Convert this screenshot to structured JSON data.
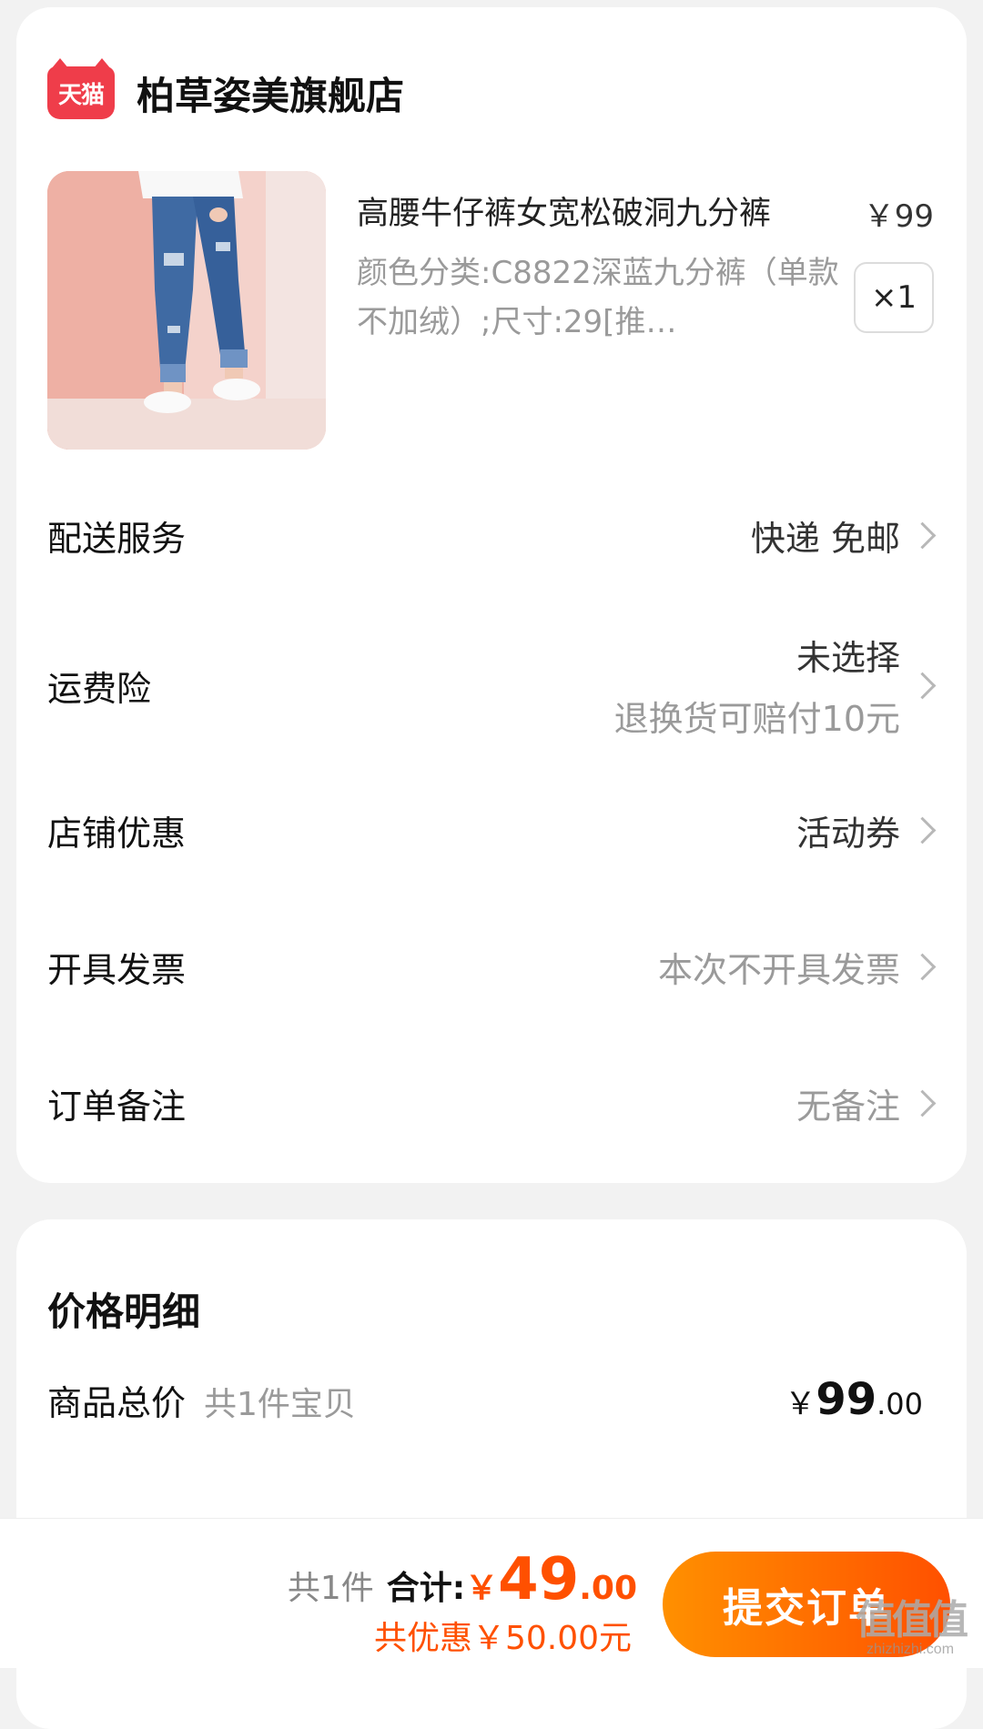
{
  "store": {
    "logo_text": "天猫",
    "name": "柏草姿美旗舰店"
  },
  "product": {
    "title": "高腰牛仔裤女宽松破洞九分裤",
    "price": "￥99",
    "sku": "颜色分类:C8822深蓝九分裤（单款不加绒）;尺寸:29[推…",
    "quantity": "×1"
  },
  "rows": {
    "delivery": {
      "label": "配送服务",
      "value": "快递 免邮"
    },
    "shipping_insurance": {
      "label": "运费险",
      "value": "未选择",
      "sub": "退换货可赔付10元"
    },
    "store_discount": {
      "label": "店铺优惠",
      "value": "活动券"
    },
    "invoice": {
      "label": "开具发票",
      "value": "本次不开具发票"
    },
    "order_note": {
      "label": "订单备注",
      "value": "无备注"
    }
  },
  "price_detail": {
    "title": "价格明细",
    "goods_total_label": "商品总价",
    "goods_total_hint": "共1件宝贝",
    "goods_total_currency": "￥",
    "goods_total_int": "99",
    "goods_total_dec": ".00"
  },
  "bottom_bar": {
    "count": "共1件",
    "total_label": "合计:",
    "total_currency": "￥",
    "total_int": "49",
    "total_dec": ".00",
    "discount": "共优惠￥50.00元",
    "submit_label": "提交订单"
  },
  "watermark": {
    "mark": "值值值",
    "site": "zhizhizhi.com"
  },
  "colors": {
    "accent": "#ff5000",
    "tmall_red": "#ef3d4a"
  }
}
